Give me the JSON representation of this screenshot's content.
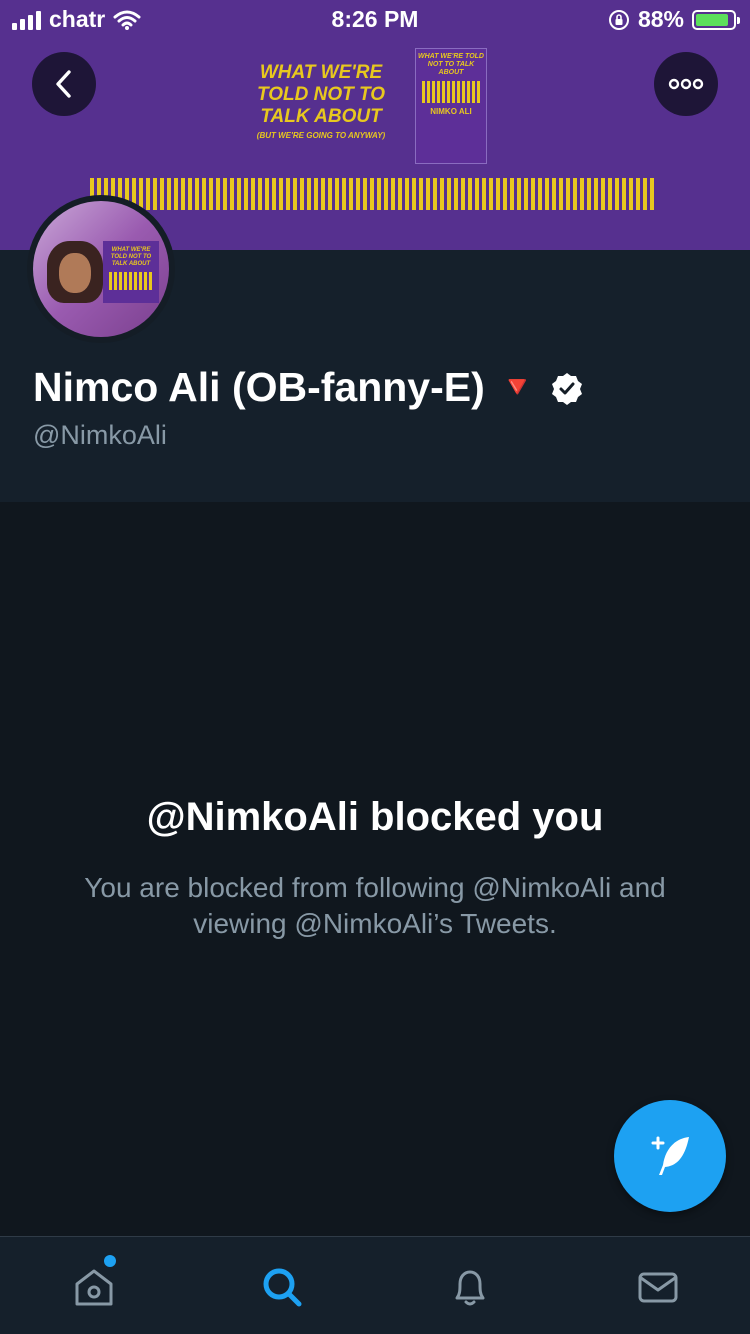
{
  "status_bar": {
    "carrier": "chatr",
    "time": "8:26 PM",
    "battery_percent": "88%"
  },
  "banner": {
    "title_lines": [
      "WHAT WE'RE",
      "TOLD NOT TO",
      "TALK ABOUT"
    ],
    "subtitle": "(BUT WE'RE GOING TO ANYWAY)",
    "book_title": "WHAT WE'RE TOLD NOT TO TALK ABOUT",
    "book_author": "NIMKO ALI",
    "background_color": "#56308f",
    "accent_color": "#e8c81e"
  },
  "profile": {
    "display_name": "Nimco Ali (OB-fanny-E)",
    "emoji": "🔻",
    "verified": true,
    "handle": "@NimkoAli"
  },
  "blocked": {
    "title": "@NimkoAli blocked you",
    "description": "You are blocked from following @NimkoAli and viewing @NimkoAli’s Tweets."
  },
  "tabs": [
    {
      "name": "home",
      "icon": "home-icon",
      "active": false,
      "has_notification_dot": true
    },
    {
      "name": "search",
      "icon": "search-icon",
      "active": true
    },
    {
      "name": "notifications",
      "icon": "bell-icon",
      "active": false
    },
    {
      "name": "messages",
      "icon": "mail-icon",
      "active": false
    }
  ],
  "colors": {
    "accent": "#1da1f2",
    "background": "#141d26",
    "secondary_text": "#8899a6"
  }
}
